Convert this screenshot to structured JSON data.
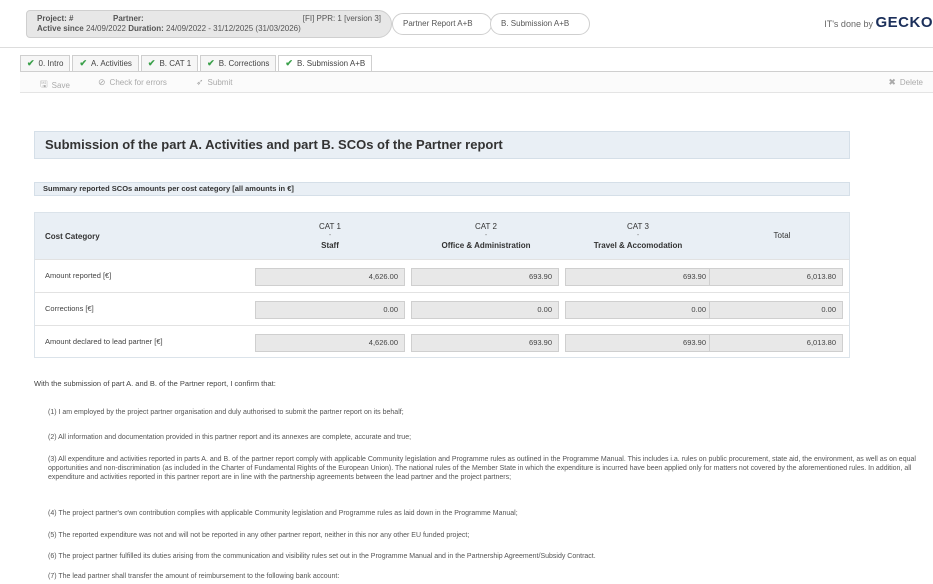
{
  "header": {
    "project_label": "Project: #",
    "partner_label": "Partner:",
    "ppr_label": "[FI] PPR: 1 [version 3]",
    "active_since_label": "Active since",
    "active_since_value": "24/09/2022",
    "duration_label": "Duration:",
    "duration_value": "24/09/2022 - 31/12/2025 (31/03/2026)",
    "crumbs": [
      "Partner Report A+B",
      "B. Submission A+B"
    ],
    "brand_prefix": "IT's done by",
    "brand_name": "GECKO"
  },
  "tabs": [
    {
      "label": "0. Intro",
      "checked": true
    },
    {
      "label": "A. Activities",
      "checked": true
    },
    {
      "label": "B. CAT 1",
      "checked": true
    },
    {
      "label": "B. Corrections",
      "checked": true
    },
    {
      "label": "B. Submission A+B",
      "checked": true,
      "active": true
    }
  ],
  "toolbar": {
    "save": "Save",
    "check": "Check for errors",
    "submit": "Submit",
    "delete": "Delete"
  },
  "page_title": "Submission of the part A. Activities and part B. SCOs of the Partner report",
  "section_title": "Summary reported SCOs amounts per cost category [all amounts in €]",
  "table": {
    "header_cost_category": "Cost Category",
    "columns": [
      {
        "top": "CAT 1",
        "dash": "-",
        "bottom": "Staff"
      },
      {
        "top": "CAT 2",
        "dash": "-",
        "bottom": "Office & Administration"
      },
      {
        "top": "CAT 3",
        "dash": "-",
        "bottom": "Travel & Accomodation"
      },
      {
        "top": "Total",
        "dash": "",
        "bottom": ""
      }
    ],
    "rows": [
      {
        "label": "Amount reported [€]",
        "values": [
          "4,626.00",
          "693.90",
          "693.90",
          "6,013.80"
        ]
      },
      {
        "label": "Corrections [€]",
        "values": [
          "0.00",
          "0.00",
          "0.00",
          "0.00"
        ]
      },
      {
        "label": "Amount declared to lead partner [€]",
        "values": [
          "4,626.00",
          "693.90",
          "693.90",
          "6,013.80"
        ]
      }
    ]
  },
  "declaration_intro": "With the submission of part A. and B. of the Partner report, I confirm that:",
  "declarations": [
    "(1) I am employed by the project partner organisation and duly authorised to submit the partner report on its behalf;",
    "(2) All information and documentation provided in this partner report and its annexes are complete, accurate and true;",
    "(3) All expenditure and activities reported in parts A. and B. of the partner report comply with applicable Community legislation and Programme rules as outlined in the Programme Manual. This includes i.a. rules on public procurement, state aid, the environment, as well as on equal opportunities and non-discrimination (as included in the Charter of Fundamental Rights of the European Union). The national rules of the Member State in which the expenditure is incurred have been applied only for matters not covered by the aforementioned rules. In addition, all expenditure and activities reported in this partner report are in line with the partnership agreements between the lead partner and the project partners;",
    "(4) The project partner's own contribution complies with applicable Community legislation and Programme rules as laid down in the Programme Manual;",
    "(5) The reported expenditure was not and will not be reported in any other partner report, neither in this nor any other EU funded project;",
    "(6) The project partner fulfilled its duties arising from the communication and visibility rules set out in the Programme Manual and in the Partnership Agreement/Subsidy Contract.",
    "(7) The lead partner shall transfer the amount of reimbursement to the following bank account:"
  ]
}
